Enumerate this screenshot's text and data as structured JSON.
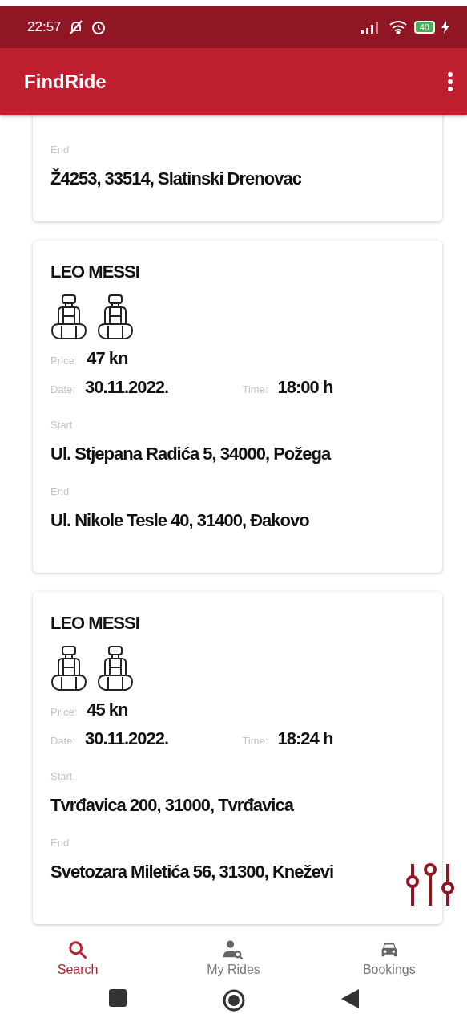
{
  "status_bar": {
    "time": "22:57",
    "battery": "40"
  },
  "app_bar": {
    "title": "FindRide"
  },
  "rides": [
    {
      "end_label": "End",
      "end": "Ž4253, 33514, Slatinski Drenovac"
    },
    {
      "driver": "LEO MESSI",
      "seats": [
        {
          "kind": "seat"
        },
        {
          "kind": "seat"
        }
      ],
      "price_label": "Price:",
      "price": "47 kn",
      "date_label": "Date:",
      "date": "30.11.2022.",
      "time_label": "Time:",
      "time": "18:00 h",
      "start_label": "Start",
      "start": "Ul. Stjepana Radića 5, 34000, Požega",
      "end_label": "End",
      "end": "Ul. Nikole Tesle 40, 31400, Đakovo"
    },
    {
      "driver": "LEO MESSI",
      "seats": [
        {
          "kind": "seat"
        },
        {
          "kind": "seat"
        }
      ],
      "price_label": "Price:",
      "price": "45 kn",
      "date_label": "Date:",
      "date": "30.11.2022.",
      "time_label": "Time:",
      "time": "18:24 h",
      "start_label": "Start",
      "start": "Tvrđavica 200, 31000, Tvrđavica",
      "end_label": "End",
      "end": "Svetozara Miletića 56, 31300, Kneževi"
    }
  ],
  "bottom_nav": [
    {
      "label": "Search",
      "selected": true
    },
    {
      "label": "My Rides",
      "selected": false
    },
    {
      "label": "Bookings",
      "selected": false
    }
  ]
}
